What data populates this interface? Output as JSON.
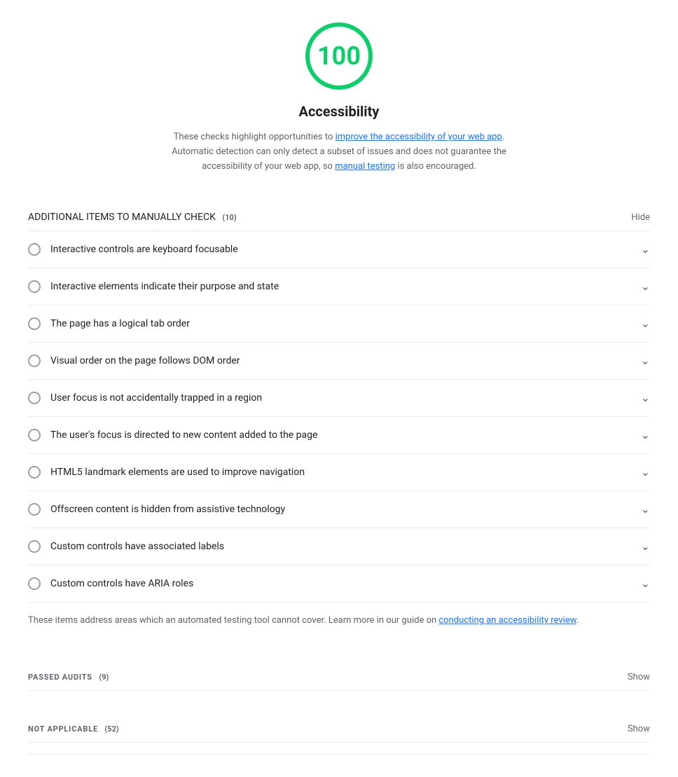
{
  "score": {
    "value": "100",
    "color": "#0cce6b",
    "title": "Accessibility",
    "description_prefix": "These checks highlight opportunities to ",
    "link1_text": "improve the accessibility of your web app",
    "description_middle": ". Automatic detection can only detect a subset of issues and does not guarantee the accessibility of your web app, so ",
    "link2_text": "manual testing",
    "description_suffix": " is also encouraged."
  },
  "manual_section": {
    "title": "ADDITIONAL ITEMS TO MANUALLY CHECK",
    "count": "(10)",
    "toggle_label": "Hide"
  },
  "audit_items": [
    {
      "id": "keyboard-focusable",
      "label": "Interactive controls are keyboard focusable"
    },
    {
      "id": "interactive-element-affordance",
      "label": "Interactive elements indicate their purpose and state"
    },
    {
      "id": "logical-tab-order",
      "label": "The page has a logical tab order"
    },
    {
      "id": "visual-order-follows-dom",
      "label": "Visual order on the page follows DOM order"
    },
    {
      "id": "focus-traps",
      "label": "User focus is not accidentally trapped in a region"
    },
    {
      "id": "managed-focus",
      "label": "The user's focus is directed to new content added to the page"
    },
    {
      "id": "use-landmarks",
      "label": "HTML5 landmark elements are used to improve navigation"
    },
    {
      "id": "offscreen-content-hidden",
      "label": "Offscreen content is hidden from assistive technology"
    },
    {
      "id": "custom-controls-labels",
      "label": "Custom controls have associated labels"
    },
    {
      "id": "custom-controls-roles",
      "label": "Custom controls have ARIA roles"
    }
  ],
  "manual_check_note": {
    "text_prefix": "These items address areas which an automated testing tool cannot cover. Learn more in our guide on ",
    "link_text": "conducting an accessibility review",
    "text_suffix": "."
  },
  "passed_section": {
    "title": "PASSED AUDITS",
    "count": "(9)",
    "toggle_label": "Show"
  },
  "not_applicable_section": {
    "title": "NOT APPLICABLE",
    "count": "(52)",
    "toggle_label": "Show"
  },
  "icons": {
    "chevron_down": "›",
    "circle_empty": ""
  }
}
